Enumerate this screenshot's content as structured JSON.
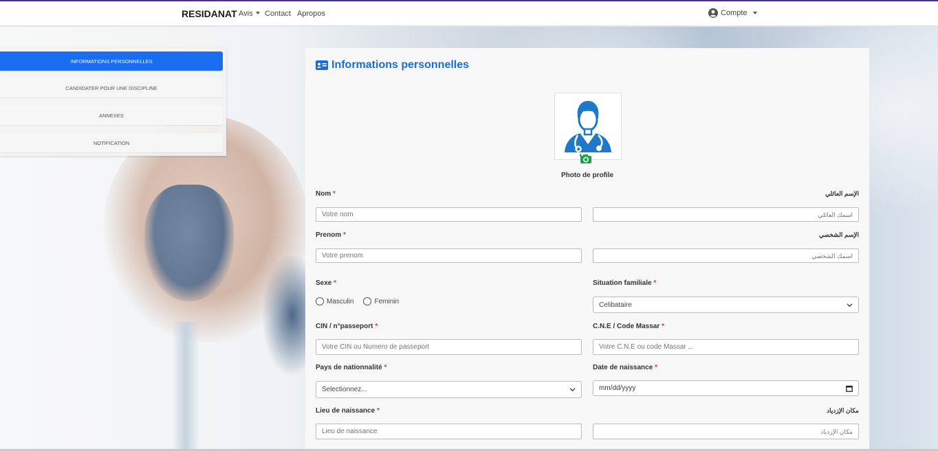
{
  "navbar": {
    "brand": "RESIDANAT",
    "links": [
      "Avis",
      "Contact",
      "Apropos"
    ],
    "account": "Compte"
  },
  "sidebar": {
    "items": [
      {
        "label": "INFORMATIONS PERSONNELLES",
        "active": true
      },
      {
        "label": "CANDIDATER POUR UNE DISCIPLINE",
        "active": false
      },
      {
        "label": "ANNEXES",
        "active": false
      },
      {
        "label": "NOTIFICATION",
        "active": false
      }
    ]
  },
  "form": {
    "title": "Informations personnelles",
    "photo_caption": "Photo de profile",
    "required_mark": "*",
    "nom": {
      "label": "Nom",
      "label_ar": "الإسم العائلي",
      "placeholder": "Votre nom",
      "placeholder_ar": "اسمك العائلي"
    },
    "prenom": {
      "label": "Prenom",
      "label_ar": "الإسم الشخصي",
      "placeholder": "Votre prenom",
      "placeholder_ar": "اسمك الشخصي"
    },
    "sexe": {
      "label": "Sexe",
      "options": [
        "Masculin",
        "Feminin"
      ]
    },
    "situation": {
      "label": "Situation familiale",
      "value": "Celibataire"
    },
    "cin": {
      "label": "CIN / n°passeport",
      "placeholder": "Votre CIN ou Numero de passeport"
    },
    "cne": {
      "label": "C.N.E / Code Massar",
      "placeholder": "Votre C.N.E ou code Massar ..."
    },
    "pays": {
      "label": "Pays de nationnalité",
      "value": "Selectionnez..."
    },
    "date": {
      "label": "Date de naissance",
      "value": "mm/dd/yyyy"
    },
    "lieu": {
      "label": "Lieu de naissance",
      "label_ar": "مكان الإزدياد",
      "placeholder": "Lieu de naissance",
      "placeholder_ar": "مكان الإزدياد"
    }
  },
  "colors": {
    "accent": "#1a6cf0",
    "title": "#1a6cd8",
    "required": "#e53935",
    "camera": "#16a34a",
    "avatar": "#1f78c8"
  }
}
